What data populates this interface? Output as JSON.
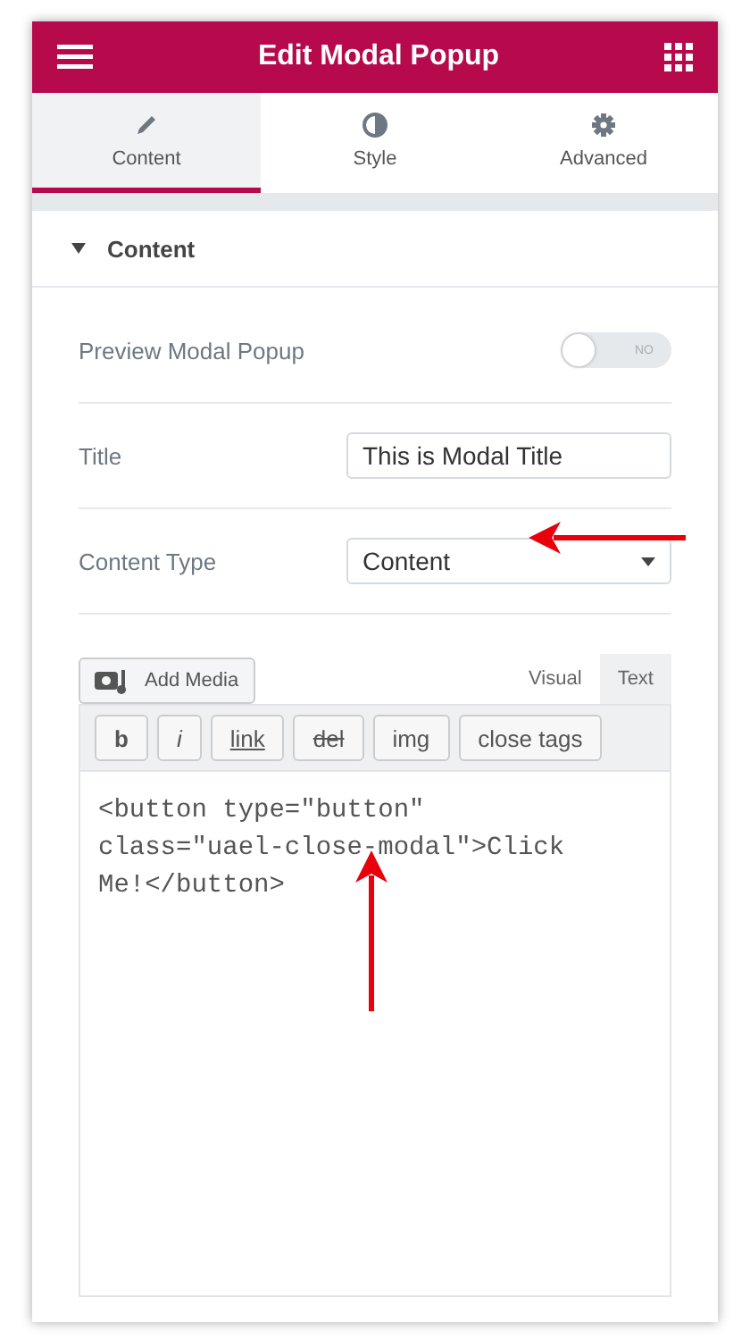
{
  "header": {
    "title": "Edit Modal Popup"
  },
  "tabs": [
    {
      "label": "Content",
      "selected": true
    },
    {
      "label": "Style",
      "selected": false
    },
    {
      "label": "Advanced",
      "selected": false
    }
  ],
  "section": {
    "title": "Content",
    "expanded": true
  },
  "controls": [
    {
      "kind": "toggle",
      "label": "Preview Modal Popup",
      "on": false,
      "state_text": "NO"
    },
    {
      "kind": "text",
      "label": "Title",
      "value": "This is Modal Title"
    },
    {
      "kind": "select",
      "label": "Content Type",
      "value": "Content"
    }
  ],
  "editor": {
    "add_media": "Add Media",
    "modes": [
      {
        "label": "Visual",
        "selected": false
      },
      {
        "label": "Text",
        "selected": true
      }
    ],
    "quicktags": [
      {
        "label": "b"
      },
      {
        "label": "i"
      },
      {
        "label": "link"
      },
      {
        "label": "del"
      },
      {
        "label": "img"
      },
      {
        "label": "close tags"
      }
    ],
    "code": "<button type=\"button\" class=\"uael-close-modal\">Click Me!</button>"
  },
  "annotations": [
    {
      "kind": "arrow"
    },
    {
      "kind": "arrow"
    }
  ]
}
